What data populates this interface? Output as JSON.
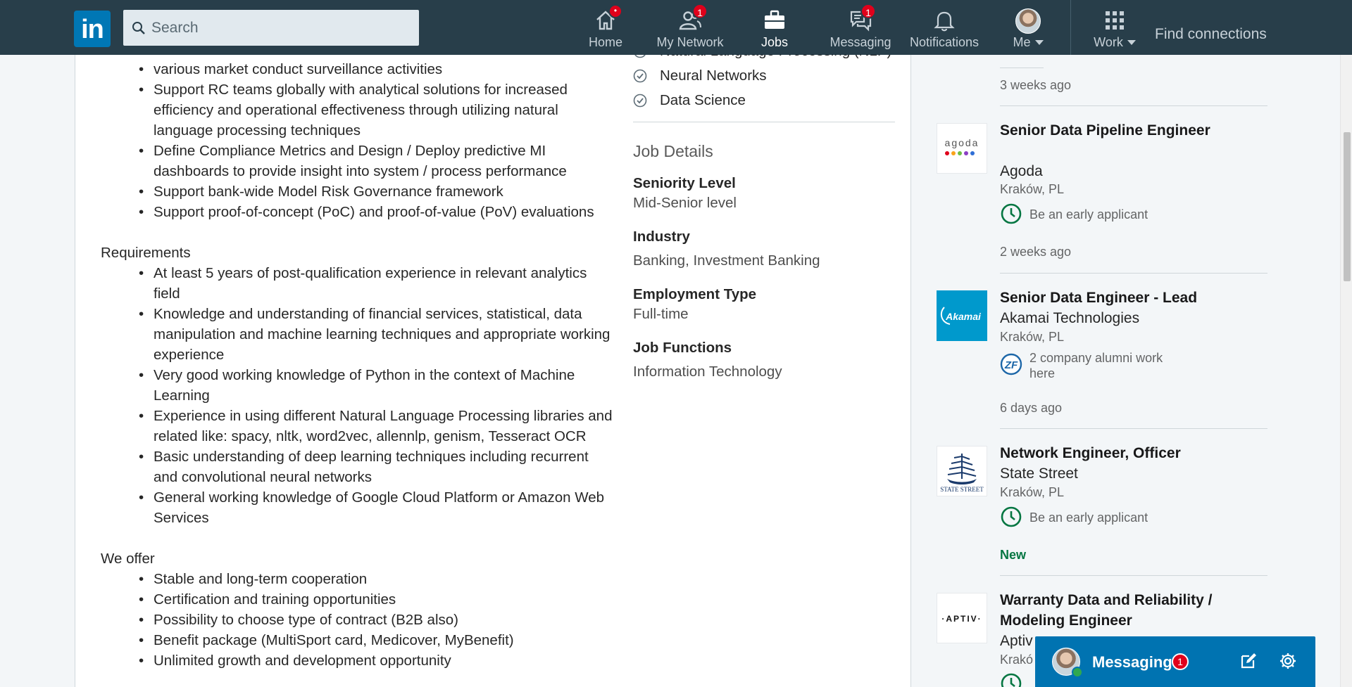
{
  "topnav": {
    "logo_text": "in",
    "search_placeholder": "Search",
    "items": [
      {
        "label": "Home",
        "icon": "home-icon",
        "badge": "•"
      },
      {
        "label": "My Network",
        "icon": "network-icon",
        "badge": "1"
      },
      {
        "label": "Jobs",
        "icon": "briefcase-icon",
        "badge": ""
      },
      {
        "label": "Messaging",
        "icon": "messaging-icon",
        "badge": "1"
      },
      {
        "label": "Notifications",
        "icon": "bell-icon",
        "badge": ""
      },
      {
        "label": "Me",
        "icon": "avatar",
        "badge": ""
      },
      {
        "label": "Work",
        "icon": "grid-icon",
        "badge": ""
      }
    ],
    "find_connections": "Find connections",
    "colors": {
      "bar": "#283e4a",
      "badge": "#e0001b",
      "inactive": "#c7d1d8"
    }
  },
  "description": {
    "intro_fragment": "various market conduct surveillance activities",
    "responsibilities_tail": [
      "Support RC teams globally with analytical solutions for increased efficiency and operational effectiveness through utilizing natural language processing techniques",
      "Define Compliance Metrics and Design / Deploy predictive MI dashboards to provide insight into system / process performance",
      "Support bank-wide Model Risk Governance framework",
      "Support proof-of-concept (PoC) and proof-of-value (PoV) evaluations"
    ],
    "requirements_title": "Requirements",
    "requirements": [
      "At least 5 years of post-qualification experience in relevant analytics field",
      "Knowledge and understanding of financial services, statistical, data manipulation and machine learning techniques and appropriate working experience",
      "Very good working knowledge of Python in the context of Machine Learning",
      "Experience in using different Natural Language Processing libraries and related like: spacy, nltk, word2vec, allennlp, genism, Tesseract OCR",
      "Basic understanding of deep learning techniques including recurrent and convolutional neural networks",
      "General working knowledge of Google Cloud Platform or Amazon Web Services"
    ],
    "offer_title": "We offer",
    "offer": [
      "Stable and long-term cooperation",
      "Certification and training opportunities",
      "Possibility to choose type of contract (B2B also)",
      "Benefit package (MultiSport card, Medicover, MyBenefit)",
      "Unlimited growth and development opportunity"
    ]
  },
  "skills": {
    "items": [
      {
        "label": "Natural Language Processing (NLP)"
      },
      {
        "label": "Neural Networks"
      },
      {
        "label": "Data Science"
      }
    ]
  },
  "job_details": {
    "title": "Job Details",
    "seniority_label": "Seniority Level",
    "seniority_value": "Mid-Senior level",
    "industry_label": "Industry",
    "industry_value": "Banking, Investment Banking",
    "employment_label": "Employment Type",
    "employment_value": "Full-time",
    "functions_label": "Job Functions",
    "functions_value": "Information Technology"
  },
  "similar_jobs": [
    {
      "time": "3 weeks ago"
    },
    {
      "title": "Senior Data Pipeline Engineer",
      "company": "Agoda",
      "location": "Kraków, PL",
      "meta": "Be an early applicant",
      "time": "2 weeks ago",
      "logo": "agoda"
    },
    {
      "title": "Senior Data Engineer - Lead",
      "company": "Akamai Technologies",
      "location": "Kraków, PL",
      "meta": "2 company alumni work here",
      "time": "6 days ago",
      "logo": "Akamai"
    },
    {
      "title": "Network Engineer, Officer",
      "company": "State Street",
      "location": "Kraków, PL",
      "meta": "Be an early applicant",
      "time": "New",
      "logo": "STATE STREET"
    },
    {
      "title": "Warranty Data and Reliability / Modeling Engineer",
      "company": "Aptiv",
      "location": "Krakó",
      "logo": "·APTIV·"
    }
  ],
  "messaging_widget": {
    "label": "Messaging",
    "badge": "1",
    "colors": {
      "bar": "#0073b1",
      "online": "#2fa84f"
    }
  }
}
